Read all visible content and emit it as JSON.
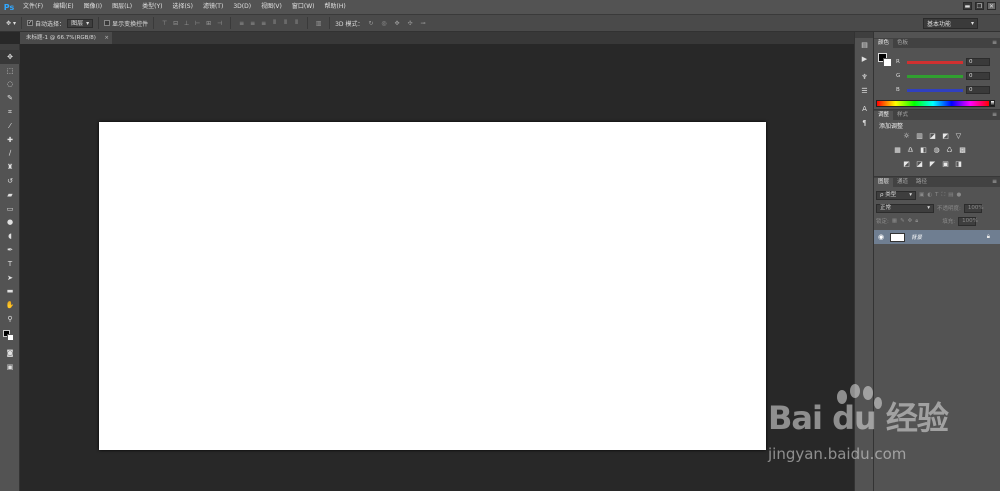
{
  "app": {
    "logo": "Ps"
  },
  "menu": [
    "文件(F)",
    "编辑(E)",
    "图像(I)",
    "图层(L)",
    "类型(Y)",
    "选择(S)",
    "滤镜(T)",
    "3D(D)",
    "视图(V)",
    "窗口(W)",
    "帮助(H)"
  ],
  "window_controls": {
    "minimize": "▬",
    "restore": "❐",
    "close": "✕"
  },
  "options": {
    "auto_select_label": "自动选择：",
    "auto_select_value": "图层",
    "show_transform_label": "显示变换控件",
    "mode_3d_label": "3D 模式：",
    "workspace": "基本功能"
  },
  "document_tab": {
    "title": "未标题-1 @ 66.7%(RGB/8)",
    "close": "×"
  },
  "tools": [
    {
      "name": "move-tool-icon",
      "glyph": "✥"
    },
    {
      "name": "marquee-tool-icon",
      "glyph": "⬚"
    },
    {
      "name": "lasso-tool-icon",
      "glyph": "◌"
    },
    {
      "name": "quick-select-tool-icon",
      "glyph": "✎"
    },
    {
      "name": "crop-tool-icon",
      "glyph": "⌗"
    },
    {
      "name": "eyedropper-tool-icon",
      "glyph": "⁄"
    },
    {
      "name": "healing-brush-tool-icon",
      "glyph": "✚"
    },
    {
      "name": "brush-tool-icon",
      "glyph": "∕"
    },
    {
      "name": "clone-stamp-tool-icon",
      "glyph": "♜"
    },
    {
      "name": "history-brush-tool-icon",
      "glyph": "↺"
    },
    {
      "name": "eraser-tool-icon",
      "glyph": "▰"
    },
    {
      "name": "gradient-tool-icon",
      "glyph": "▭"
    },
    {
      "name": "blur-tool-icon",
      "glyph": "●"
    },
    {
      "name": "dodge-tool-icon",
      "glyph": "◖"
    },
    {
      "name": "pen-tool-icon",
      "glyph": "✒"
    },
    {
      "name": "type-tool-icon",
      "glyph": "T"
    },
    {
      "name": "path-select-tool-icon",
      "glyph": "➤"
    },
    {
      "name": "shape-tool-icon",
      "glyph": "▬"
    },
    {
      "name": "hand-tool-icon",
      "glyph": "✋"
    },
    {
      "name": "zoom-tool-icon",
      "glyph": "⚲"
    }
  ],
  "dock_icons": [
    {
      "name": "history-panel-icon",
      "glyph": "▤"
    },
    {
      "name": "actions-panel-icon",
      "glyph": "▶"
    },
    {
      "name": "brush-panel-icon",
      "glyph": "♆"
    },
    {
      "name": "properties-panel-icon",
      "glyph": "☰"
    },
    {
      "name": "character-panel-icon",
      "glyph": "A"
    },
    {
      "name": "paragraph-panel-icon",
      "glyph": "¶"
    }
  ],
  "color_panel": {
    "tabs": [
      "颜色",
      "色板"
    ],
    "sliders": [
      {
        "label": "R",
        "value": "0",
        "color": "#d03030"
      },
      {
        "label": "G",
        "value": "0",
        "color": "#30a030"
      },
      {
        "label": "B",
        "value": "0",
        "color": "#3040c0"
      }
    ]
  },
  "adjustments_panel": {
    "tabs": [
      "调整",
      "样式"
    ],
    "title": "添加调整",
    "rows": [
      [
        "☼",
        "▥",
        "◪",
        "◩",
        "▽"
      ],
      [
        "▦",
        "♎",
        "◧",
        "◍",
        "♺",
        "▩"
      ],
      [
        "◩",
        "◪",
        "◤",
        "▣",
        "◨"
      ]
    ]
  },
  "layers_panel": {
    "tabs": [
      "图层",
      "通道",
      "路径"
    ],
    "filter_label": "ρ 类型",
    "blend_mode": "正常",
    "opacity_label": "不透明度:",
    "opacity_value": "100%",
    "lock_label": "锁定:",
    "fill_label": "填充:",
    "fill_value": "100%",
    "layers": [
      {
        "name": "背景",
        "visible": true,
        "locked": true
      }
    ]
  },
  "watermark": {
    "logo": "Bai du 经验",
    "url": "jingyan.baidu.com"
  }
}
